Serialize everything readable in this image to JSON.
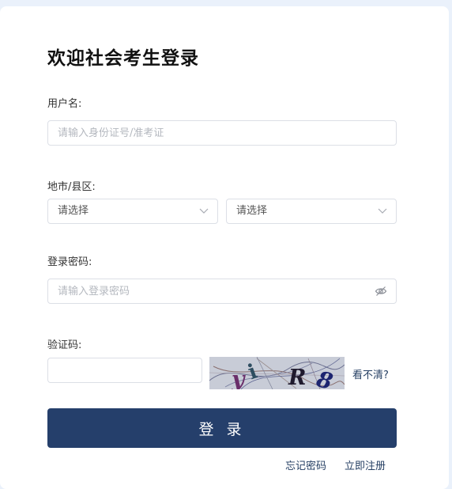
{
  "title": "欢迎社会考生登录",
  "username": {
    "label": "用户名:",
    "placeholder": "请输入身份证号/准考证",
    "value": ""
  },
  "region": {
    "label": "地市/县区:",
    "city_selected": "请选择",
    "district_selected": "请选择"
  },
  "password": {
    "label": "登录密码:",
    "placeholder": "请输入登录密码",
    "value": ""
  },
  "captcha": {
    "label": "验证码:",
    "value": "",
    "refresh_label": "看不清?",
    "image_text": "yiR8"
  },
  "login_button": "登 录",
  "links": {
    "forgot_password": "忘记密码",
    "register": "立即注册"
  },
  "colors": {
    "primary": "#253f6b",
    "link": "#253f63",
    "background": "#eaf1fb"
  }
}
